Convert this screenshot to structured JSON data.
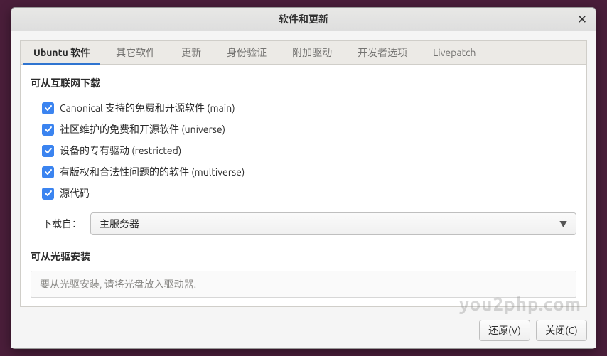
{
  "window": {
    "title": "软件和更新"
  },
  "tabs": {
    "ubuntu": "Ubuntu 软件",
    "other": "其它软件",
    "updates": "更新",
    "auth": "身份验证",
    "drivers": "附加驱动",
    "dev": "开发者选项",
    "livepatch": "Livepatch"
  },
  "sections": {
    "internet_title": "可从互联网下载",
    "cd_title": "可从光驱安装"
  },
  "checkboxes": {
    "main": "Canonical 支持的免费和开源软件 (main)",
    "universe": "社区维护的免费和开源软件 (universe)",
    "restricted": "设备的专有驱动 (restricted)",
    "multiverse": "有版权和合法性问题的的软件 (multiverse)",
    "source": "源代码"
  },
  "download": {
    "label": "下载自：",
    "selected": "主服务器"
  },
  "cd": {
    "placeholder": "要从光驱安装, 请将光盘放入驱动器."
  },
  "buttons": {
    "revert": "还原(V)",
    "close": "关闭(C)"
  },
  "watermark": "you2php.com"
}
